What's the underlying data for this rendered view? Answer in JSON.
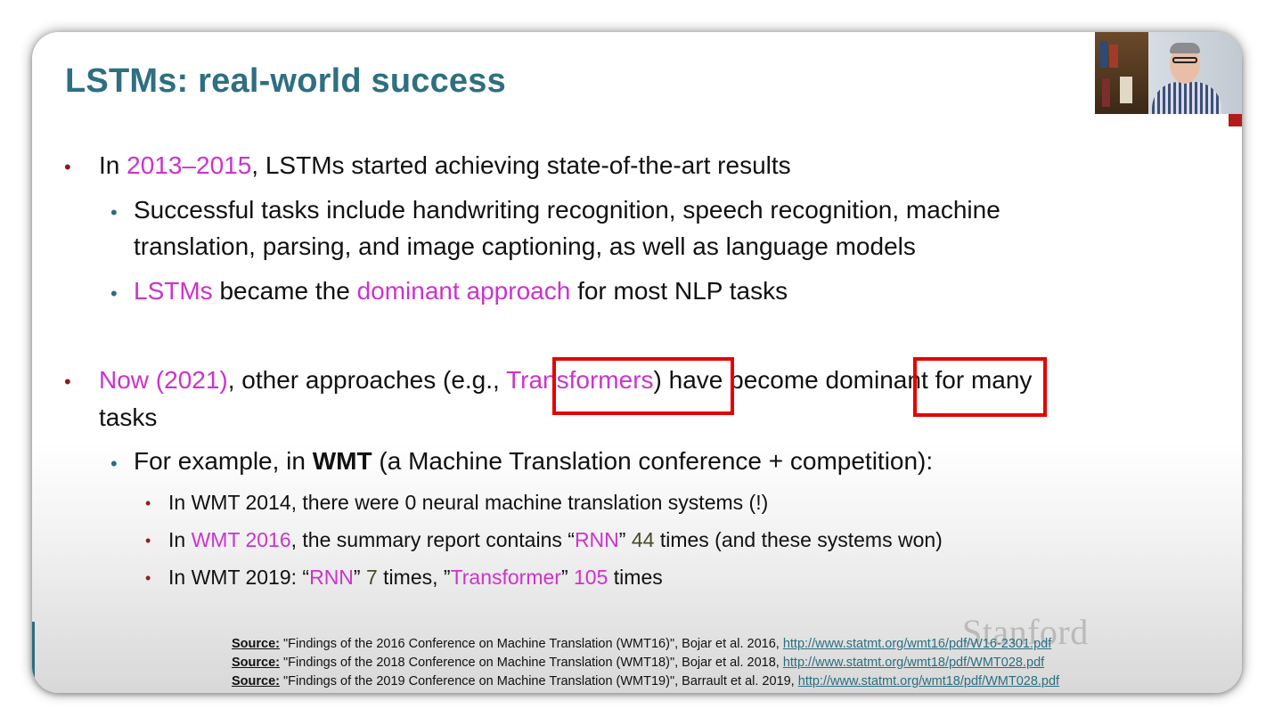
{
  "title": "LSTMs: real-world success",
  "bullet1": {
    "pre": "In ",
    "years": "2013–2015",
    "post": ", LSTMs started achieving state-of-the-art results"
  },
  "bullet1a": {
    "line1": "Successful tasks include handwriting recognition, speech recognition, machine",
    "line2": "translation, parsing, and image captioning, as well as language models"
  },
  "bullet1b": {
    "lstms": "LSTMs",
    "mid": " became the ",
    "dominant": "dominant approach",
    "post": " for most NLP tasks"
  },
  "bullet2": {
    "now": "Now (2021)",
    "mid": ", other approaches (e.g., ",
    "transformers": "Transformers",
    "mid2": ") have become ",
    "dominant": "dominant",
    "post": " for many",
    "line2": "tasks"
  },
  "bullet2a": {
    "pre": "For example, in ",
    "wmt": "WMT",
    "post": " (a Machine Translation conference + competition):"
  },
  "sub1": "In WMT 2014, there were 0 neural machine translation systems (!)",
  "sub2": {
    "pre": "In ",
    "wmt": "WMT 2016",
    "mid": ", the summary report contains “",
    "rnn": "RNN",
    "mid2": "” ",
    "count": "44",
    "post": " times (and these systems won)"
  },
  "sub3": {
    "pre": "In WMT 2019: “",
    "rnn": "RNN",
    "mid": "” ",
    "count1": "7",
    "mid2": " times, ”",
    "transformer": "Transformer",
    "mid3": "” ",
    "count2": "105",
    "post": " times"
  },
  "sources": [
    {
      "label": "Source:",
      "text": " \"Findings of the 2016 Conference on Machine Translation (WMT16)\", Bojar et al. 2016, ",
      "link": "http://www.statmt.org/wmt16/pdf/W16-2301.pdf"
    },
    {
      "label": "Source:",
      "text": " \"Findings of the 2018 Conference on Machine Translation (WMT18)\", Bojar et al. 2018, ",
      "link": "http://www.statmt.org/wmt18/pdf/WMT028.pdf"
    },
    {
      "label": "Source:",
      "text": " \"Findings of the 2019 Conference on Machine Translation (WMT19)\", Barrault et al. 2019, ",
      "link": "http://www.statmt.org/wmt18/pdf/WMT028.pdf"
    }
  ],
  "watermark": "Stanford",
  "colors": {
    "title": "#2e6f82",
    "highlight_text": "#cc33cc",
    "highlight_box": "#e60000",
    "bullet_level1": "#8c1d1d",
    "bullet_level2": "#2f6c7e"
  }
}
